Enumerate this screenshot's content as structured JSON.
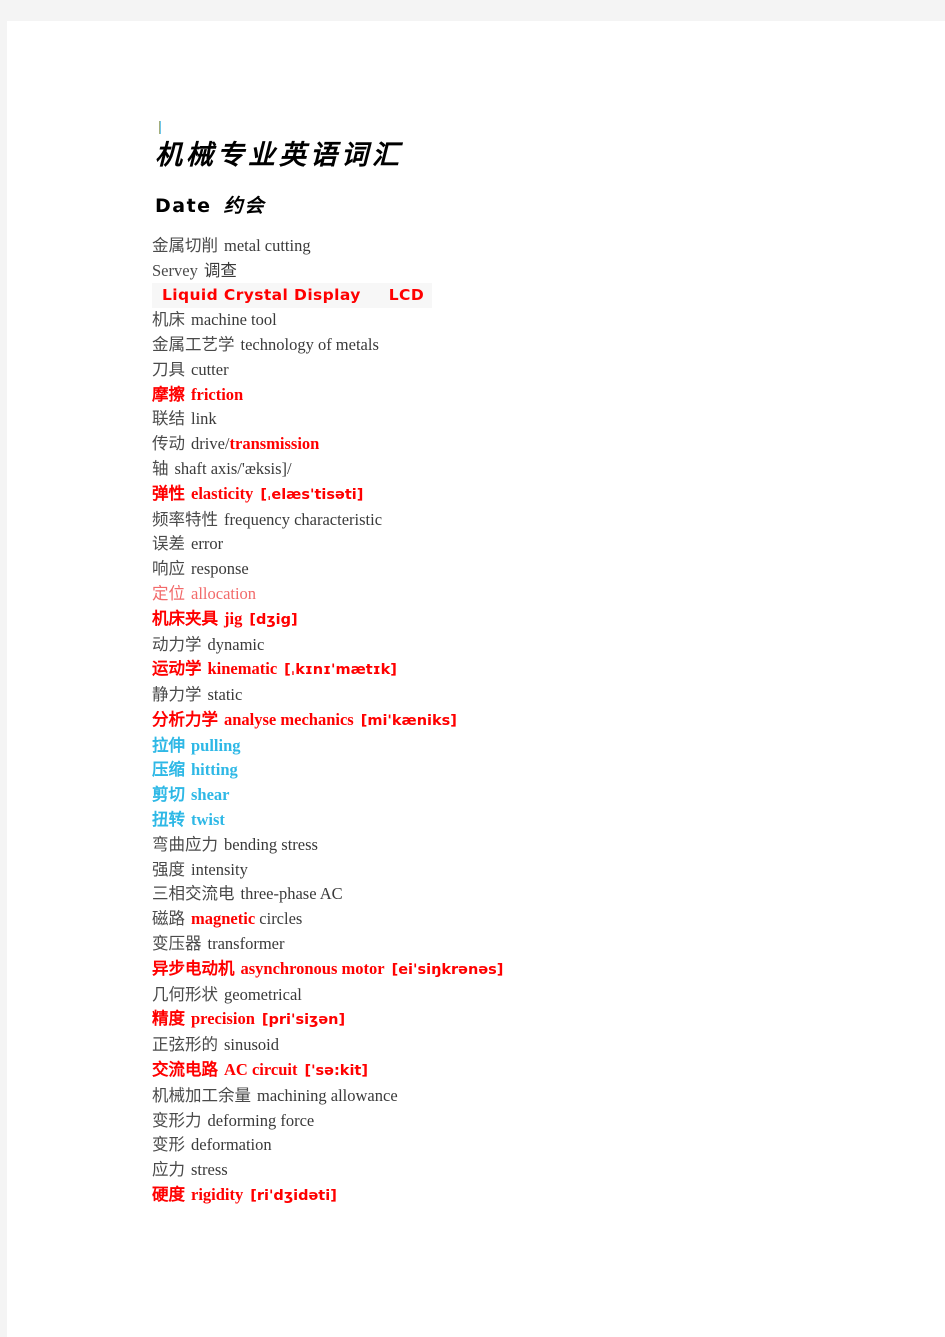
{
  "document": {
    "title": "机械专业英语词汇",
    "subtitle_label": "Date",
    "subtitle_cn": "约会"
  },
  "vocab": [
    {
      "term": "金属切削",
      "gloss": "metal  cutting",
      "ipa": "",
      "style": "plain"
    },
    {
      "term": "Servey",
      "gloss": "调查",
      "ipa": "",
      "style": "plain"
    },
    {
      "term": "Liquid  Crystal  Display",
      "gloss": "",
      "abbr": "LCD",
      "ipa": "",
      "style": "lcd"
    },
    {
      "term": "机床",
      "gloss": "machine  tool",
      "ipa": "",
      "style": "plain"
    },
    {
      "term": "金属工艺学",
      "gloss": "technology  of  metals",
      "ipa": "",
      "style": "plain"
    },
    {
      "term": "刀具",
      "gloss": "cutter",
      "ipa": "",
      "style": "plain"
    },
    {
      "term": "摩擦",
      "gloss": "friction",
      "ipa": "",
      "style": "red"
    },
    {
      "term": "联结",
      "gloss": "link",
      "ipa": "",
      "style": "plain"
    },
    {
      "term": "传动",
      "gloss_pre": "drive/",
      "gloss_hot": "transmission",
      "ipa": "",
      "style": "mixed"
    },
    {
      "term": "轴",
      "gloss": "shaft  axis/'æksis]/",
      "ipa": "",
      "style": "plain"
    },
    {
      "term": "弹性",
      "gloss": "elasticity",
      "ipa": "[ˌelæs'tisəti]",
      "style": "red"
    },
    {
      "term": "频率特性",
      "gloss": "frequency  characteristic",
      "ipa": "",
      "style": "plain"
    },
    {
      "term": "误差",
      "gloss": "error",
      "ipa": "",
      "style": "plain"
    },
    {
      "term": "响应",
      "gloss": "response",
      "ipa": "",
      "style": "plain"
    },
    {
      "term": "定位",
      "gloss": "allocation",
      "ipa": "",
      "style": "softred"
    },
    {
      "term": "机床夹具",
      "gloss": "jig",
      "ipa": "[dʒig]",
      "style": "red"
    },
    {
      "term": "动力学",
      "gloss": "dynamic",
      "ipa": "",
      "style": "plain"
    },
    {
      "term": "运动学",
      "gloss": "kinematic",
      "ipa": "[ˌkɪnɪ'mætɪk]",
      "style": "red"
    },
    {
      "term": "静力学",
      "gloss": "static",
      "ipa": "",
      "style": "plain"
    },
    {
      "term": "分析力学",
      "gloss": "analyse  mechanics",
      "ipa": "[mi'kæniks]",
      "style": "red"
    },
    {
      "term": "拉伸",
      "gloss": "pulling",
      "ipa": "",
      "style": "cyan"
    },
    {
      "term": "压缩",
      "gloss": "hitting",
      "ipa": "",
      "style": "cyan"
    },
    {
      "term": "剪切",
      "gloss": "shear",
      "ipa": "",
      "style": "cyan"
    },
    {
      "term": "扭转",
      "gloss": "twist",
      "ipa": "",
      "style": "cyan"
    },
    {
      "term": "弯曲应力",
      "gloss": "bending  stress",
      "ipa": "",
      "style": "plain"
    },
    {
      "term": "强度",
      "gloss": "intensity",
      "ipa": "",
      "style": "plain"
    },
    {
      "term": "三相交流电",
      "gloss": "three-phase  AC",
      "ipa": "",
      "style": "plain"
    },
    {
      "term": "磁路",
      "gloss_pre": "",
      "gloss_hot": "magnetic",
      "gloss_post": "  circles",
      "ipa": "",
      "style": "mixed"
    },
    {
      "term": "变压器",
      "gloss": "transformer",
      "ipa": "",
      "style": "plain"
    },
    {
      "term": "异步电动机",
      "gloss": "asynchronous  motor",
      "ipa": "[ei'siŋkrənəs]",
      "style": "red"
    },
    {
      "term": "几何形状",
      "gloss": "geometrical",
      "ipa": "",
      "style": "plain"
    },
    {
      "term": "精度",
      "gloss": "precision",
      "ipa": "[pri'siʒən]",
      "style": "red"
    },
    {
      "term": "正弦形的",
      "gloss": "sinusoid",
      "ipa": "",
      "style": "plain"
    },
    {
      "term": "交流电路",
      "gloss": "AC  circuit",
      "ipa": "['sə:kit]",
      "style": "red"
    },
    {
      "term": "机械加工余量",
      "gloss": "machining  allowance",
      "ipa": "",
      "style": "plain"
    },
    {
      "term": "变形力",
      "gloss": "deforming  force",
      "ipa": "",
      "style": "plain"
    },
    {
      "term": "变形",
      "gloss": "deformation",
      "ipa": "",
      "style": "plain"
    },
    {
      "term": "应力",
      "gloss": "stress",
      "ipa": "",
      "style": "plain"
    },
    {
      "term": "硬度",
      "gloss": "rigidity",
      "ipa": "[ri'dʒidəti]",
      "style": "red"
    }
  ],
  "colors": {
    "page_background": "#ffffff",
    "canvas_background": "#f4f4f4",
    "body_text": "#3a3a3a",
    "accent_red": "#ff0000",
    "soft_red": "#f26a6a",
    "accent_cyan": "#2eb8e6",
    "highlight": "#f7f7f7"
  }
}
